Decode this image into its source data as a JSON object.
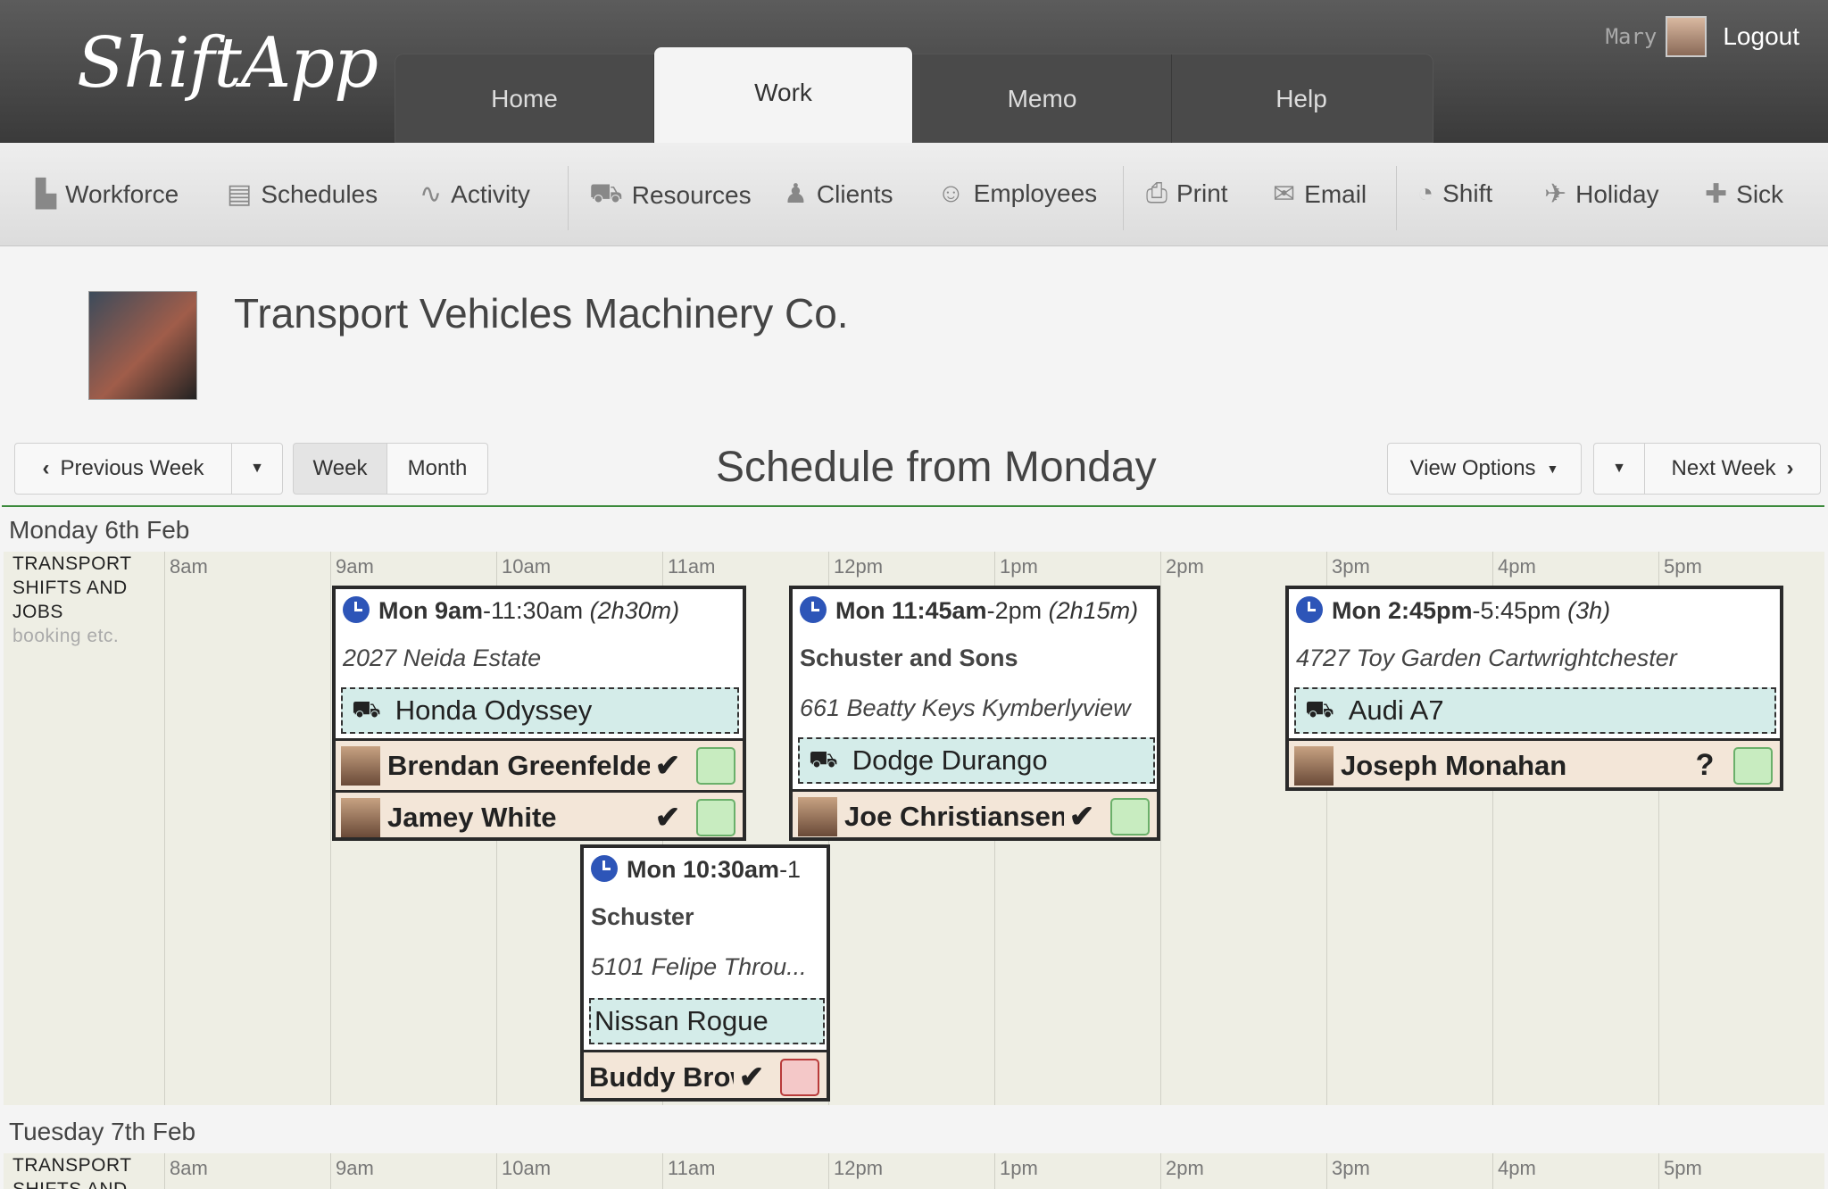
{
  "app": {
    "logo": "ShiftApp"
  },
  "tabs": [
    {
      "label": "Home"
    },
    {
      "label": "Work"
    },
    {
      "label": "Memo"
    },
    {
      "label": "Help"
    }
  ],
  "user": {
    "name": "Mary",
    "logout": "Logout"
  },
  "toolbar": [
    {
      "label": "Workforce",
      "icon": "factory-icon"
    },
    {
      "label": "Schedules",
      "icon": "clipboard-icon"
    },
    {
      "label": "Activity",
      "icon": "pulse-icon"
    },
    {
      "label": "Resources",
      "icon": "truck-icon"
    },
    {
      "label": "Clients",
      "icon": "client-icon"
    },
    {
      "label": "Employees",
      "icon": "person-icon"
    },
    {
      "label": "Print",
      "icon": "printer-icon"
    },
    {
      "label": "Email",
      "icon": "envelope-icon"
    },
    {
      "label": "Shift",
      "icon": "clock-icon"
    },
    {
      "label": "Holiday",
      "icon": "plane-icon"
    },
    {
      "label": "Sick",
      "icon": "medkit-icon"
    }
  ],
  "company": {
    "name": "Transport Vehicles Machinery Co."
  },
  "nav": {
    "previous": "Previous Week",
    "week": "Week",
    "month": "Month",
    "title": "Schedule from Monday",
    "view_options": "View Options",
    "next": "Next Week"
  },
  "hours": [
    "8am",
    "9am",
    "10am",
    "11am",
    "12pm",
    "1pm",
    "2pm",
    "3pm",
    "4pm",
    "5pm"
  ],
  "row_label": {
    "line1": "TRANSPORT",
    "line2": "SHIFTS AND",
    "line3": "JOBS",
    "sub": "booking etc."
  },
  "days": [
    {
      "title": "Monday 6th Feb"
    },
    {
      "title": "Tuesday 7th Feb"
    }
  ],
  "jobs": [
    {
      "time_bold": "Mon 9am",
      "time_rest": "-11:30am ",
      "duration": "(2h30m)",
      "client": "",
      "address": "2027 Neida Estate",
      "vehicle": "Honda Odyssey",
      "employees": [
        {
          "name": "Brendan Greenfelder",
          "status": "✔",
          "box": "green"
        },
        {
          "name": "Jamey White",
          "status": "✔",
          "box": "green"
        }
      ]
    },
    {
      "time_bold": "Mon 11:45am",
      "time_rest": "-2pm ",
      "duration": "(2h15m)",
      "client": "Schuster and Sons",
      "address": "661 Beatty Keys Kymberlyview",
      "vehicle": "Dodge Durango",
      "employees": [
        {
          "name": "Joe Christiansen",
          "status": "✔",
          "box": "green"
        }
      ]
    },
    {
      "time_bold": "Mon 2:45pm",
      "time_rest": "-5:45pm ",
      "duration": "(3h)",
      "client": "",
      "address": "4727 Toy Garden Cartwrightchester",
      "vehicle": "Audi A7",
      "employees": [
        {
          "name": "Joseph Monahan",
          "status": "?",
          "box": "green"
        }
      ]
    },
    {
      "time_bold": "Mon 10:30am",
      "time_rest": "-1",
      "duration": "",
      "client": "Schuster",
      "address": "5101 Felipe Throu...",
      "vehicle": "Nissan Rogue",
      "employees": [
        {
          "name": "Buddy Brown",
          "status": "✔",
          "box": "red"
        }
      ]
    }
  ]
}
